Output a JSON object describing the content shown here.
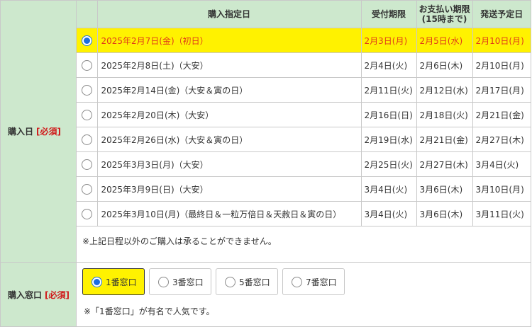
{
  "purchase_date": {
    "label": "購入日",
    "required": "[必須]",
    "headers": {
      "date": "購入指定日",
      "deadline": "受付期限",
      "payment_line1": "お支払い期限",
      "payment_line2": "(15時まで)",
      "shipping": "発送予定日"
    },
    "rows": [
      {
        "date": "2025年2月7日(金)（初日）",
        "deadline": "2月3日(月)",
        "payment": "2月5日(水)",
        "shipping": "2月10日(月)"
      },
      {
        "date": "2025年2月8日(土)（大安）",
        "deadline": "2月4日(火)",
        "payment": "2月6日(木)",
        "shipping": "2月10日(月)"
      },
      {
        "date": "2025年2月14日(金)（大安＆寅の日）",
        "deadline": "2月11日(火)",
        "payment": "2月12日(水)",
        "shipping": "2月17日(月)"
      },
      {
        "date": "2025年2月20日(木)（大安）",
        "deadline": "2月16日(日)",
        "payment": "2月18日(火)",
        "shipping": "2月21日(金)"
      },
      {
        "date": "2025年2月26日(水)（大安＆寅の日）",
        "deadline": "2月19日(水)",
        "payment": "2月21日(金)",
        "shipping": "2月27日(木)"
      },
      {
        "date": "2025年3月3日(月)（大安）",
        "deadline": "2月25日(火)",
        "payment": "2月27日(木)",
        "shipping": "3月4日(火)"
      },
      {
        "date": "2025年3月9日(日)（大安）",
        "deadline": "3月4日(火)",
        "payment": "3月6日(木)",
        "shipping": "3月10日(月)"
      },
      {
        "date": "2025年3月10日(月)（最終日＆一粒万倍日＆天赦日＆寅の日）",
        "deadline": "3月4日(火)",
        "payment": "3月6日(木)",
        "shipping": "3月11日(火)"
      }
    ],
    "selected_index": 0,
    "note": "※上記日程以外のご購入は承ることができません。"
  },
  "purchase_window": {
    "label": "購入窓口",
    "required": "[必須]",
    "options": [
      "1番窓口",
      "3番窓口",
      "5番窓口",
      "7番窓口"
    ],
    "selected_index": 0,
    "note": "※「1番窓口」が有名で人気です。"
  },
  "colors": {
    "label_bg": "#cde8cd",
    "selected_bg": "#fff200",
    "selected_text": "#e03a1a",
    "required_text": "#d01c1c",
    "radio_blue": "#1a6de0"
  }
}
